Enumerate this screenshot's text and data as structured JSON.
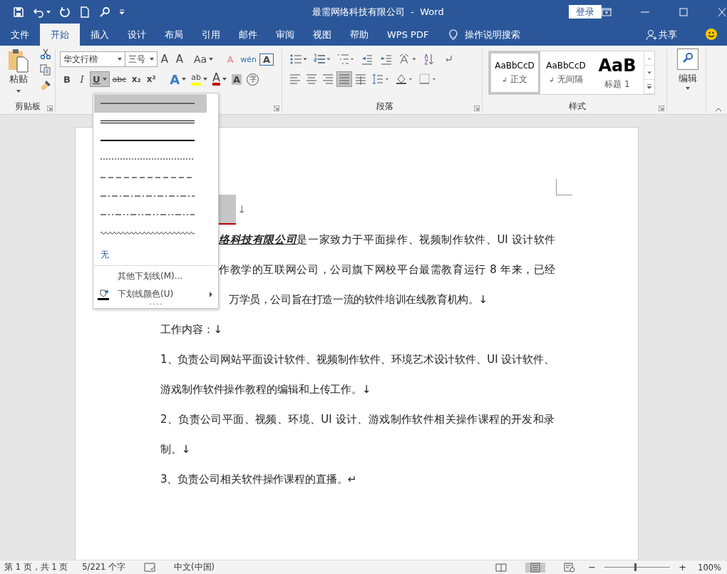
{
  "title_bar": {
    "title": "最需网络科技有限公司  -  Word",
    "login": "登录"
  },
  "ribbon_tabs": [
    {
      "label": "文件",
      "selected": false
    },
    {
      "label": "开始",
      "selected": true
    },
    {
      "label": "插入",
      "selected": false
    },
    {
      "label": "设计",
      "selected": false
    },
    {
      "label": "布局",
      "selected": false
    },
    {
      "label": "引用",
      "selected": false
    },
    {
      "label": "邮件",
      "selected": false
    },
    {
      "label": "审阅",
      "selected": false
    },
    {
      "label": "视图",
      "selected": false
    },
    {
      "label": "帮助",
      "selected": false
    },
    {
      "label": "WPS PDF",
      "selected": false
    }
  ],
  "tell_me": "操作说明搜索",
  "share": "共享",
  "clipboard": {
    "paste": "粘贴",
    "label": "剪贴板"
  },
  "font": {
    "name": "华文行楷",
    "size": "三号",
    "row1": [
      {
        "kind": "grow",
        "text": "A"
      },
      {
        "kind": "shrink",
        "text": "A"
      },
      {
        "kind": "case",
        "text": "Aa"
      },
      {
        "kind": "clear",
        "text": "A"
      },
      {
        "kind": "pinyin",
        "text": "wén"
      },
      {
        "kind": "border",
        "text": "A"
      }
    ],
    "row2": [
      {
        "kind": "bold",
        "text": "B",
        "selected": false
      },
      {
        "kind": "italic",
        "text": "I",
        "selected": false
      },
      {
        "kind": "underline",
        "text": "U",
        "selected": true
      },
      {
        "kind": "strike",
        "text": "abc",
        "selected": false
      },
      {
        "kind": "sub",
        "text": "x₂",
        "selected": false
      },
      {
        "kind": "sup",
        "text": "x²",
        "selected": false
      },
      {
        "kind": "effect",
        "text": "A",
        "selected": false
      },
      {
        "kind": "highlight",
        "text": "ab",
        "selected": false,
        "color": "#ffff00"
      },
      {
        "kind": "color",
        "text": "A",
        "selected": false,
        "color": "#c00000"
      },
      {
        "kind": "shade",
        "text": "A",
        "selected": false
      },
      {
        "kind": "enclose",
        "text": "字",
        "selected": false
      }
    ]
  },
  "paragraph": {
    "label": "段落",
    "align": [
      {
        "selected": false
      },
      {
        "selected": false
      },
      {
        "selected": false
      },
      {
        "selected": true
      },
      {
        "selected": false
      }
    ]
  },
  "styles": {
    "label": "样式",
    "items": [
      {
        "sample": "AaBbCcD",
        "mark": "↲",
        "name": "正文",
        "selected": true,
        "kind": "body"
      },
      {
        "sample": "AaBbCcD",
        "mark": "↲",
        "name": "无间隔",
        "selected": false,
        "kind": "body"
      },
      {
        "sample": "AaB",
        "name": "标题 1",
        "selected": false,
        "kind": "heading"
      }
    ]
  },
  "editing": {
    "label": "编辑"
  },
  "underline_menu": {
    "options": [
      {
        "kind": "single",
        "selected": true
      },
      {
        "kind": "double",
        "selected": false
      },
      {
        "kind": "thick",
        "selected": false
      },
      {
        "kind": "dotted",
        "selected": false
      },
      {
        "kind": "dashed",
        "selected": false
      },
      {
        "kind": "dashdot",
        "selected": false
      },
      {
        "kind": "dashdotdot",
        "selected": false
      },
      {
        "kind": "wave",
        "selected": false
      }
    ],
    "none": "无",
    "more": "其他下划线(M)...",
    "color_item": "下划线颜色(U)"
  },
  "document": {
    "title_mark": "↓",
    "intro_lines": [
      "**络科技有限公司**是一家致力于平面操作、视频制作软件、UI 设计软件",
      "作教学的互联网公司，公司旗下网校平台最需教育运行 8 年来，已经",
      "万学员，公司旨在打造一流的软件培训在线教育机构。↓"
    ],
    "paragraphs": [
      "工作内容：↓",
      "1、负责公司网站平面设计软件、视频制作软件、环境艺术设计软件、UI 设计软件、游戏制作软件操作教程的编辑和上传工作。↓",
      "2、负责公司平面、视频、环境、UI 设计、游戏制作软件相关操作课程的开发和录制。↓",
      "3、负责公司相关软件操作课程的直播。↵"
    ]
  },
  "status_bar": {
    "page": "第 1 页，共 1 页",
    "words": "5/221 个字",
    "language": "中文(中国)",
    "zoom_out": "−",
    "zoom_slider": {
      "level": 0.45
    },
    "zoom_in": "+",
    "zoom": "100%"
  }
}
